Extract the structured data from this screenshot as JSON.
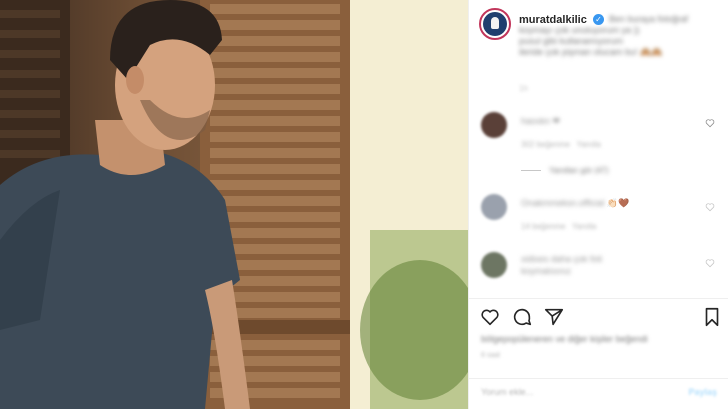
{
  "post": {
    "photo_alt": "",
    "author": {
      "username": "muratdalkilic",
      "verified_glyph": "✓"
    },
    "caption": {
      "line1": "Ben buraya fotoğraf",
      "line2": "koymayı çok unutuyorum ya ))",
      "line3": "pusul gibi kullanamıyorum",
      "line4": "ileride çok pişman olucam bu!",
      "emoji": "🙈🙈"
    },
    "time": "1h"
  },
  "comments": [
    {
      "user": "haoxkn",
      "text": "❤",
      "meta_likes": "302 beğenme",
      "meta_reply": "Yanıtla"
    },
    {
      "user": "Onakmmeksn.official",
      "text": "👏🏻🤎",
      "meta_likes": "14 beğenme",
      "meta_reply": "Yanıtla"
    },
    {
      "user": "xidixes",
      "text": "daha çok foti",
      "line2": "koymalısınız",
      "meta_likes": "",
      "meta_reply": ""
    }
  ],
  "replies_link": "Yanıtları gör (47)",
  "likes_text": "bölgepopüleneren ve diğer kişiler beğendi",
  "posted_ago": "8 saat",
  "add_comment": {
    "placeholder": "Yorum ekle...",
    "post_label": "Paylaş"
  },
  "icons": {
    "heart": "heart-icon",
    "comment": "comment-icon",
    "share": "share-icon",
    "bookmark": "bookmark-icon"
  },
  "colors": {
    "verified": "#3897f0",
    "avatar_ring": "#c1365b",
    "post_button_disabled": "#b2dffc"
  }
}
